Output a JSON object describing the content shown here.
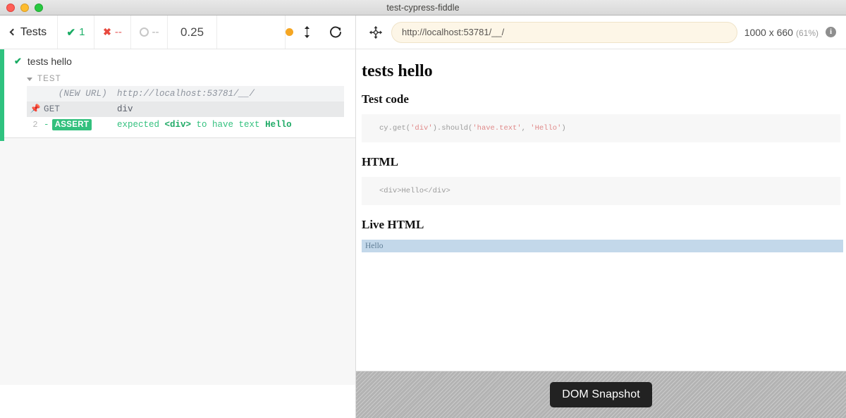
{
  "window": {
    "title": "test-cypress-fiddle",
    "traffic_lights": [
      "close-red",
      "minimize-yellow",
      "zoom-green"
    ]
  },
  "reporter_header": {
    "back_label": "Tests",
    "stats": [
      {
        "name": "passed",
        "icon": "check-icon",
        "value": "1",
        "color": "#19ab63"
      },
      {
        "name": "failed",
        "icon": "x-icon",
        "value": "--",
        "color": "#e84a3f"
      },
      {
        "name": "pending",
        "icon": "ring-icon",
        "value": "--",
        "color": "#b0b0b0"
      }
    ],
    "duration": "0.25",
    "controls": [
      {
        "name": "studio-dot",
        "icon": "amber-dot-icon"
      },
      {
        "name": "auto-scroll-toggle",
        "icon": "up-down-arrow-icon"
      },
      {
        "name": "restart-button",
        "icon": "restart-icon"
      }
    ]
  },
  "runnables": {
    "test_title": "tests hello",
    "test_status_icon": "check-icon",
    "hook_label": "TEST",
    "commands": [
      {
        "number": "",
        "pin": "",
        "method": "(NEW URL)",
        "message": "http://localhost:53781/__/",
        "type": "url"
      },
      {
        "number": "",
        "pin": "pin-icon",
        "method": "GET",
        "message": "div",
        "type": "pinned"
      },
      {
        "number": "2",
        "pin": "",
        "method": "ASSERT",
        "prefix": "-",
        "message_parts": [
          "expected ",
          "<div>",
          " to have text ",
          "Hello"
        ],
        "message": "expected <div> to have text Hello",
        "type": "assert"
      }
    ]
  },
  "aut_header": {
    "selector_playground_icon": "crosshair-icon",
    "url": "http://localhost:53781/__/",
    "url_placeholder": "http://localhost:53781/__/",
    "viewport": "1000 x 660",
    "scale": "(61%)",
    "info_icon": "info-icon"
  },
  "aut_page": {
    "heading": "tests hello",
    "sections": [
      {
        "title": "Test code",
        "code_plain_1": "cy.get(",
        "code_str_1": "'div'",
        "code_plain_2": ").should(",
        "code_str_2": "'have.text'",
        "code_plain_3": ", ",
        "code_str_3": "'Hello'",
        "code_plain_4": ")",
        "code_full": "cy.get('div').should('have.text', 'Hello')"
      },
      {
        "title": "HTML",
        "code_full": "<div>Hello</div>"
      },
      {
        "title": "Live HTML",
        "live_text": "Hello"
      }
    ]
  },
  "snapshot_bar": {
    "label": "DOM Snapshot"
  },
  "colors": {
    "pass_green": "#19ab63",
    "assert_green": "#32c07d",
    "fail_red": "#e84a3f",
    "rail_green": "#2fc27f",
    "url_bar_bg": "#fdf6e7",
    "highlight_blue": "#c3d8ea",
    "snapshot_gray": "#b3b3b3"
  }
}
